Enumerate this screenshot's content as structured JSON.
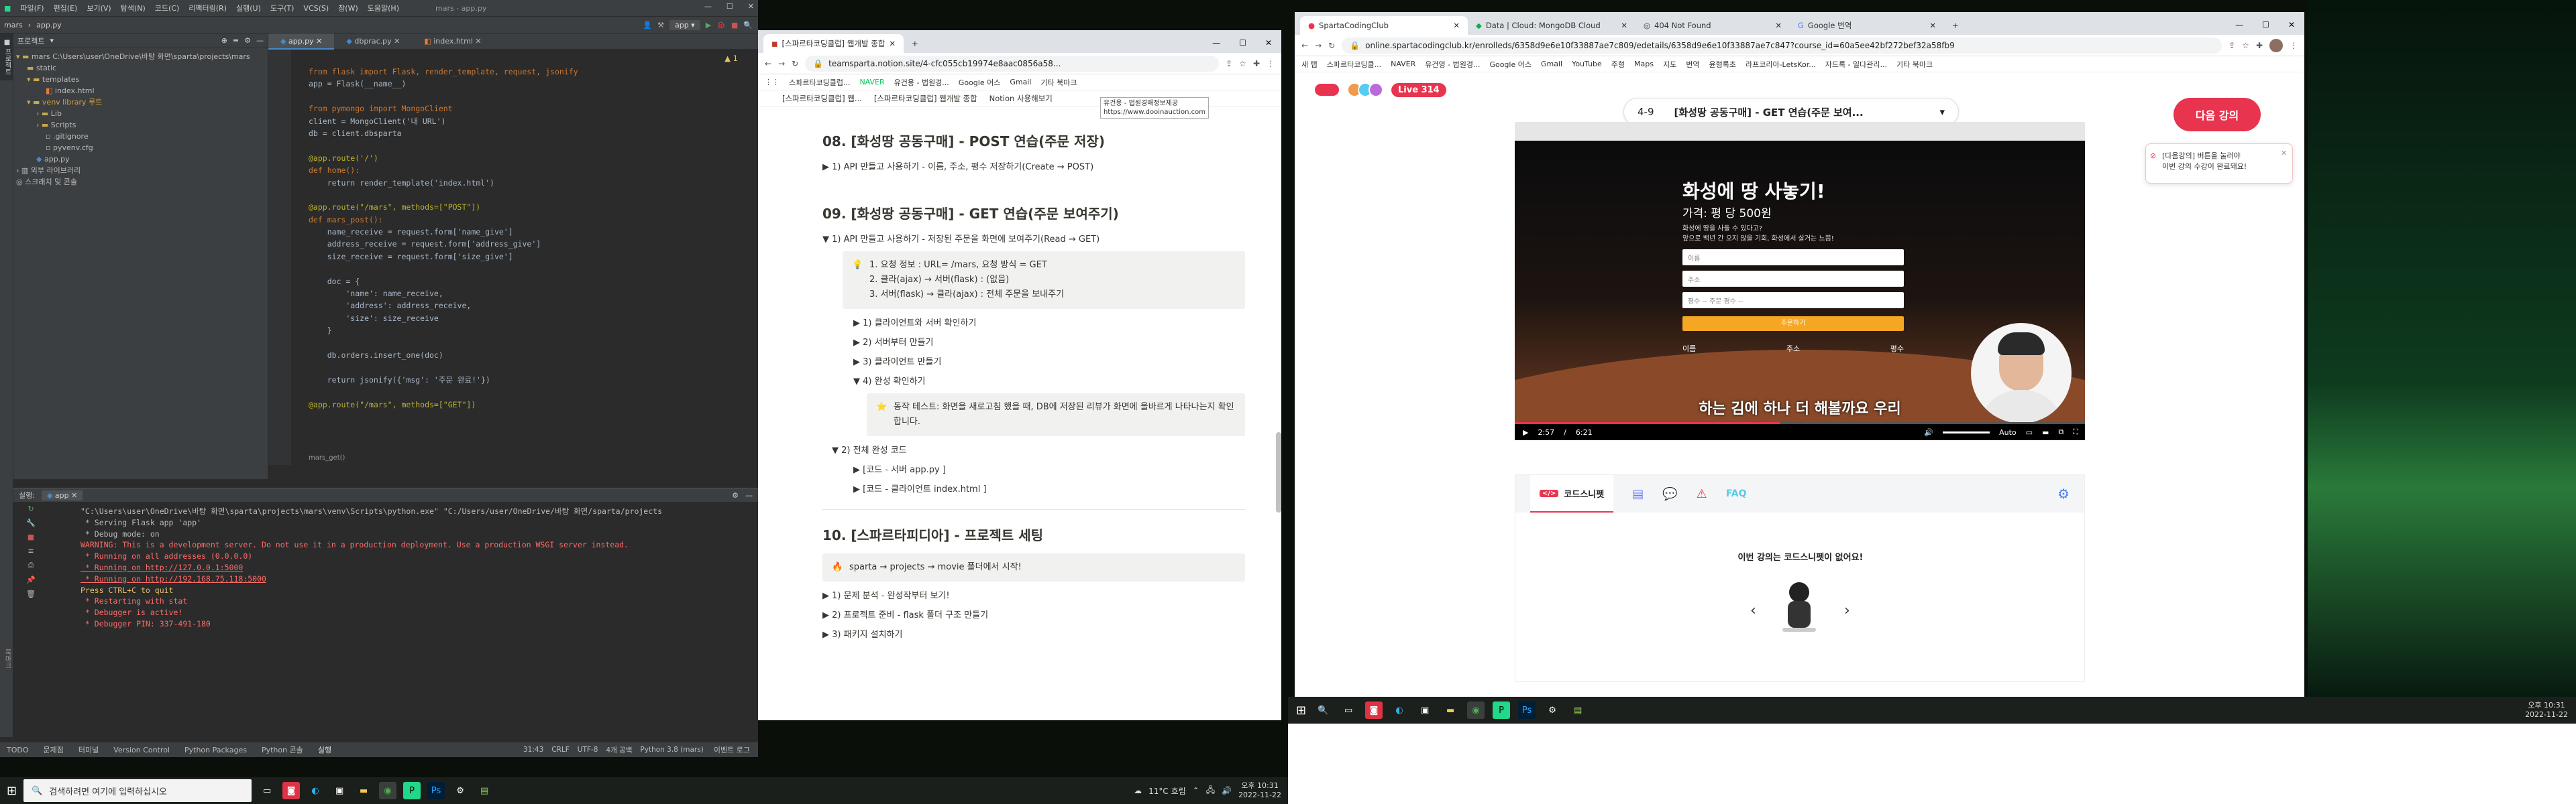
{
  "ide": {
    "menu": [
      "파일(F)",
      "편집(E)",
      "보기(V)",
      "탐색(N)",
      "코드(C)",
      "리팩터링(R)",
      "실행(U)",
      "도구(T)",
      "VCS(S)",
      "창(W)",
      "도움말(H)"
    ],
    "title": "mars - app.py",
    "breadcrumb": [
      "mars",
      "app.py"
    ],
    "run_config": "app",
    "project_label": "프로젝트",
    "tree": [
      "mars  C:\\Users\\user\\OneDrive\\바탕 화면\\sparta\\projects\\mars",
      "static",
      "templates",
      "index.html",
      "venv  library 루트",
      "Lib",
      "Scripts",
      ".gitignore",
      "pyvenv.cfg",
      "app.py",
      "외부 라이브러리",
      "스크래치 및 콘솔"
    ],
    "tabs": [
      "app.py",
      "dbprac.py",
      "index.html"
    ],
    "code": [
      "from flask import Flask, render_template, request, jsonify",
      "app = Flask(__name__)",
      "",
      "from pymongo import MongoClient",
      "client = MongoClient('내 URL')",
      "db = client.dbsparta",
      "",
      "@app.route('/')",
      "def home():",
      "    return render_template('index.html')",
      "",
      "@app.route(\"/mars\", methods=[\"POST\"])",
      "def mars_post():",
      "    name_receive = request.form['name_give']",
      "    address_receive = request.form['address_give']",
      "    size_receive = request.form['size_give']",
      "",
      "    doc = {",
      "        'name': name_receive,",
      "        'address': address_receive,",
      "        'size': size_receive",
      "    }",
      "",
      "    db.orders.insert_one(doc)",
      "",
      "    return jsonify({'msg': '주문 완료!'})",
      "",
      "@app.route(\"/mars\", methods=[\"GET\"])"
    ],
    "editor_footer": "mars_get()",
    "warn_count": "1",
    "run_tab_label": "실행:",
    "run_tab": "app",
    "console": [
      "\"C:\\Users\\user\\OneDrive\\바탕 화면\\sparta\\projects\\mars\\venv\\Scripts\\python.exe\" \"C:/Users/user/OneDrive/바탕 화면/sparta/projects",
      " * Serving Flask app 'app'",
      " * Debug mode: on",
      "WARNING: This is a development server. Do not use it in a production deployment. Use a production WSGI server instead.",
      " * Running on all addresses (0.0.0.0)",
      " * Running on http://127.0.0.1:5000",
      " * Running on http://192.168.75.118:5000",
      "Press CTRL+C to quit",
      " * Restarting with stat",
      " * Debugger is active!",
      " * Debugger PIN: 337-491-180"
    ],
    "status_tabs": [
      "TODO",
      "문제점",
      "터미널",
      "Version Control",
      "Python Packages",
      "Python 콘솔",
      "실행"
    ],
    "status_right": [
      "31:43",
      "CRLF",
      "UTF-8",
      "4개 공백",
      "Python 3.8 (mars)"
    ],
    "event_log": "이벤트 로그"
  },
  "notion": {
    "tabs": [
      "[스파르타코딩클럽] 웹개발 종합",
      "+"
    ],
    "url": "teamsparta.notion.site/4-cfc055cb19974e8aac0856a58...",
    "bookmarks": [
      "스파르타코딩클럽...",
      "NAVER",
      "유건용 - 법원경...",
      "Google 어스",
      "Gmail",
      "기타 북마크"
    ],
    "nav": [
      "[스파르타코딩클럽] 웹...",
      "[스파르타코딩클럽] 웹개발 종합",
      "Notion 사용해보기"
    ],
    "tooltip_lines": [
      "유건용 - 법원경매정보제공",
      "https://www.dooinauction.com"
    ],
    "sec08_title": "08. [화성땅 공동구매] - POST 연습(주문 저장)",
    "sec08_item": "1) API 만들고 사용하기 - 이름, 주소, 평수 저장하기(Create → POST)",
    "sec09_title": "09. [화성땅 공동구매] - GET 연습(주문 보여주기)",
    "sec09_item": "1) API 만들고 사용하기 - 저장된 주문을 화면에 보여주기(Read → GET)",
    "callout_lines": [
      "1. 요청 정보 : URL= /mars, 요청 방식 = GET",
      "2. 클라(ajax) → 서버(flask) : (없음)",
      "3. 서버(flask) → 클라(ajax) : 전체 주문을 보내주기"
    ],
    "steps": [
      "1) 클라이언트와 서버 확인하기",
      "2) 서버부터 만들기",
      "3) 클라이언트 만들기",
      "4) 완성 확인하기"
    ],
    "test_note": "동작 테스트: 화면을 새로고침 했을 때, DB에 저장된 리뷰가 화면에 올바르게 나타나는지 확인합니다.",
    "full_code": "2) 전체 완성 코드",
    "code_server": "[코드 - 서버  app.py ]",
    "code_client": "[코드 - 클라이언트  index.html ]",
    "sec10_title": "10. [스파르타피디아] - 프로젝트 세팅",
    "sec10_callout": "sparta → projects → movie 폴더에서 시작!",
    "sec10_items": [
      "1) 문제 분석 - 완성작부터 보기!",
      "2) 프로젝트 준비 - flask 폴더 구조 만들기",
      "3) 패키지 설치하기"
    ]
  },
  "sparta": {
    "tabs": [
      "SpartaCodingClub",
      "Data | Cloud: MongoDB Cloud",
      "404 Not Found",
      "Google 번역",
      "+"
    ],
    "url": "online.spartacodingclub.kr/enrolleds/6358d9e6e10f33887ae7c809/edetails/6358d9e6e10f33887ae7c847?course_id=60a5ee42bf272bef32a58fb9",
    "bookmarks": [
      "새 탭",
      "스파르타코딩클...",
      "NAVER",
      "유건영 - 법원경...",
      "Google 어스",
      "Gmail",
      "YouTube",
      "주형",
      "Maps",
      "지도",
      "번역",
      "윤형록초",
      "라프코리아-LetsKor...",
      "자드록 - 일다관리...",
      "기타 북마크"
    ],
    "live_label": "Live",
    "live_count": "314",
    "lecture_num": "4-9",
    "lecture_title": "[화성땅 공동구매] - GET 연습(주문 보여...",
    "next_button": "다음 강의",
    "toast_lines": [
      "[다음강의] 버튼을 눌러야",
      "이번 강의 수강이 완료돼요!"
    ],
    "video": {
      "inner_title": "화성에 땅 사놓기!",
      "price": "가격: 평 당 500원",
      "desc": [
        "화성에 땅을 사둘 수 있다고?",
        "앞으로 백년 간 오지 않을 기회, 화성에서 살거는 느쯤!"
      ],
      "fields": [
        "이름",
        "주소",
        "평수"
      ],
      "select_placeholder": "-- 주문 평수 --",
      "button": "주문하기",
      "table_heads": [
        "이름",
        "주소",
        "평수"
      ],
      "subtitle": "하는 김에 하나 더 해볼까요 우리",
      "time_current": "2:57",
      "time_total": "6:21",
      "speed": "Auto",
      "progress": 0.465
    },
    "snippet_title": "코드스니펫",
    "snippet_empty": "이번 강의는 코드스니펫이 없어요!"
  },
  "taskbar_left": {
    "search_placeholder": "검색하려면 여기에 입력하십시오",
    "weather": "11°C 흐림",
    "time": "오후 10:31",
    "date": "2022-11-22"
  },
  "taskbar_right": {
    "time": "오후 10:31",
    "date": "2022-11-22"
  }
}
